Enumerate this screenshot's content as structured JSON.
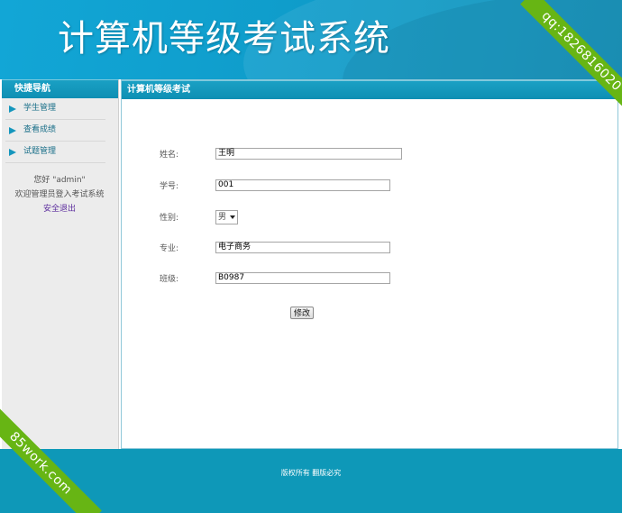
{
  "header": {
    "title": "计算机等级考试系统"
  },
  "sidebar": {
    "title": "快捷导航",
    "items": [
      {
        "label": "学生管理"
      },
      {
        "label": "查看成绩"
      },
      {
        "label": "试题管理"
      }
    ],
    "greeting": "您好 \"admin\"",
    "welcome": "欢迎管理员登入考试系统",
    "logout": "安全退出"
  },
  "main": {
    "title": "计算机等级考试",
    "form": {
      "name_label": "姓名:",
      "name_value": "王明",
      "id_label": "学号:",
      "id_value": "001",
      "gender_label": "性别:",
      "gender_value": "男",
      "major_label": "专业:",
      "major_value": "电子商务",
      "class_label": "班级:",
      "class_value": "B0987",
      "submit_label": "修改"
    }
  },
  "footer": {
    "text": "版权所有 翻版必究"
  },
  "watermarks": {
    "top_right": "qq:1826816020",
    "bottom_left": "85work.com"
  },
  "colors": {
    "header": "#0f9dcb",
    "footer": "#0e98b8",
    "ribbon": "#67b514"
  }
}
